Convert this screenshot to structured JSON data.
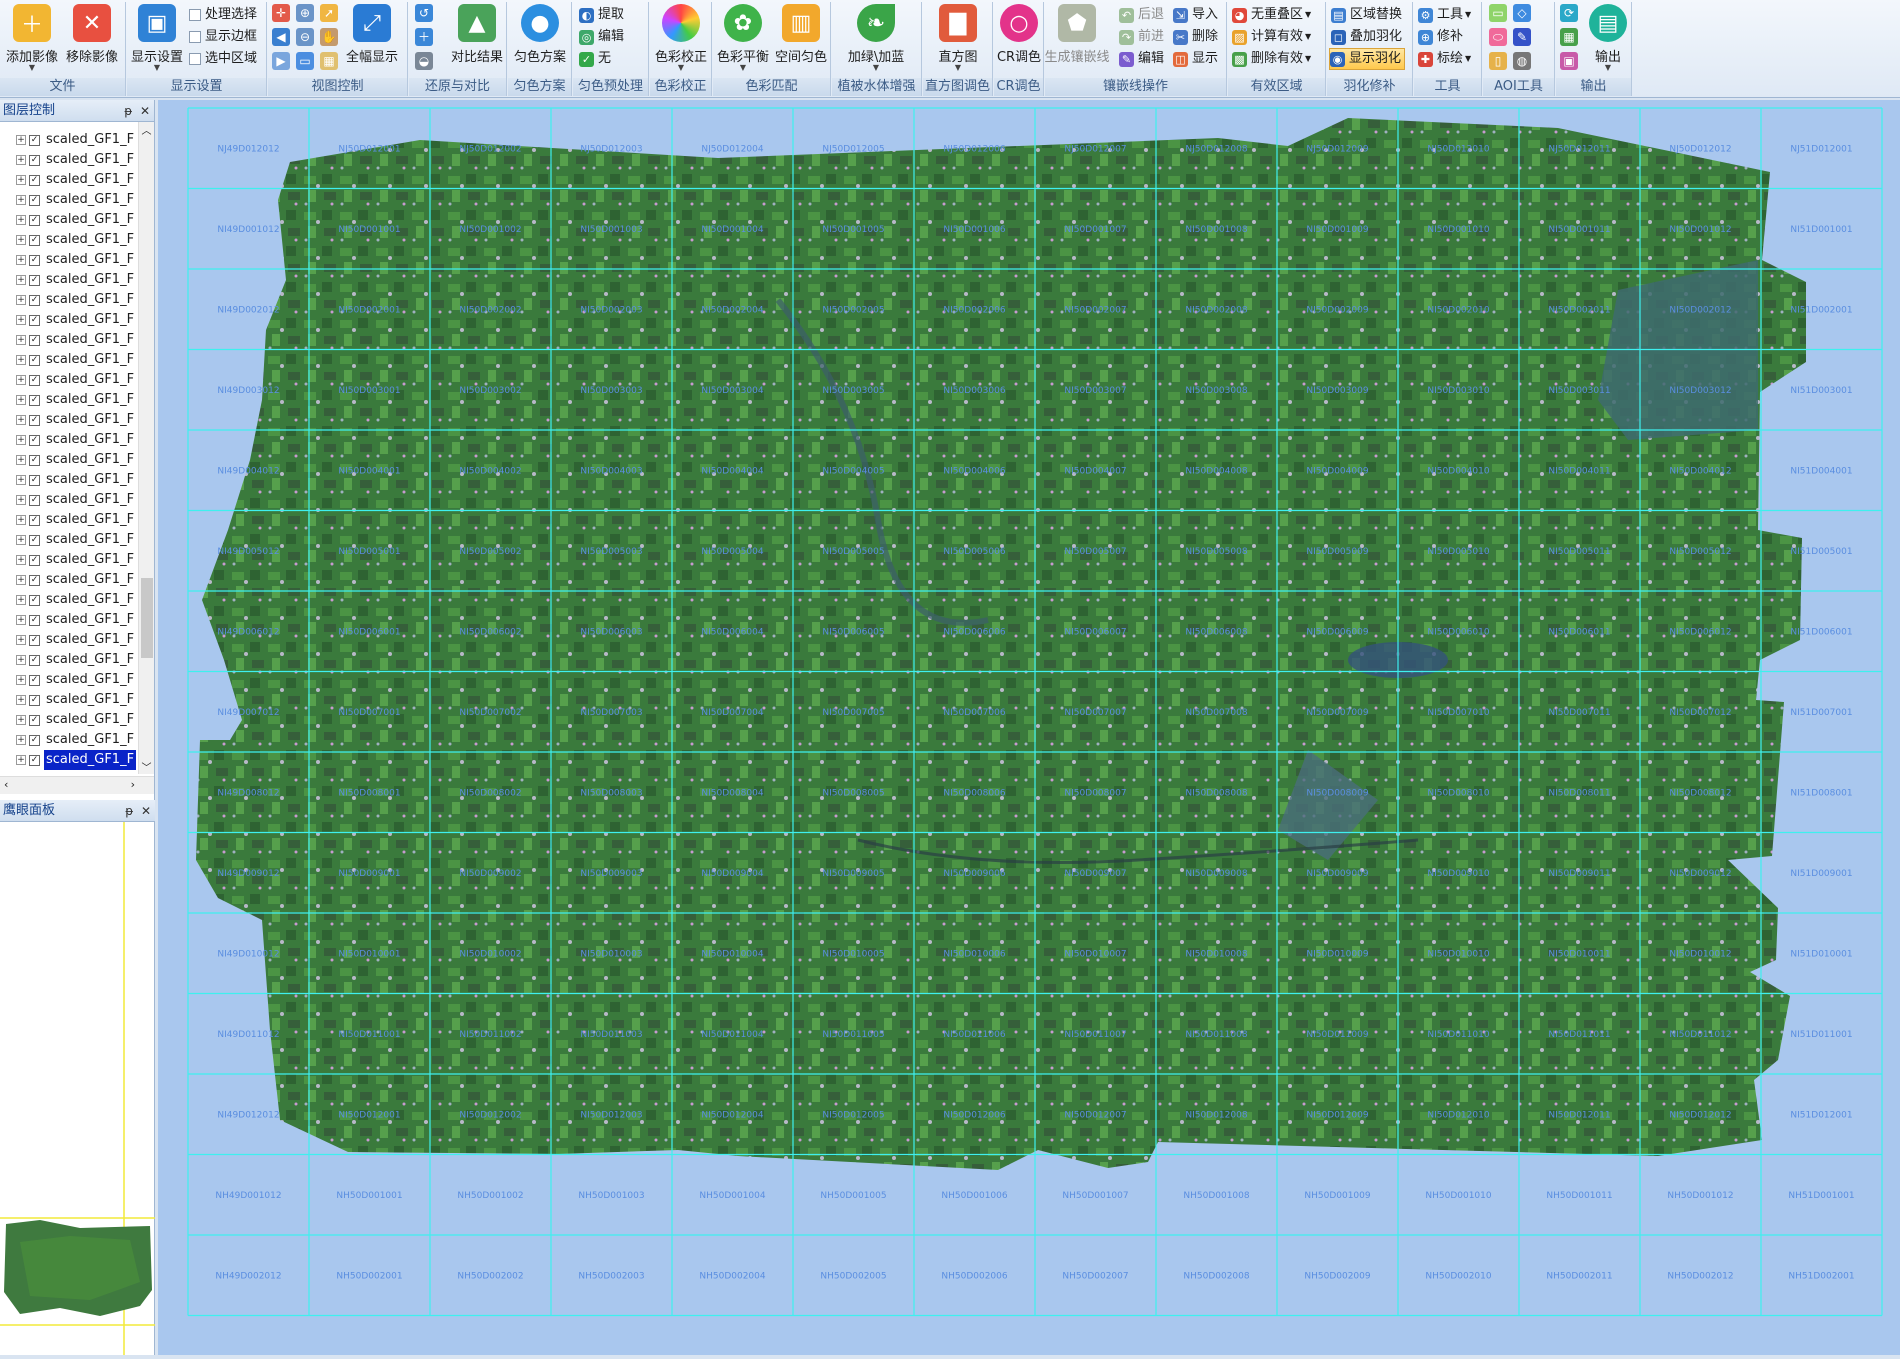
{
  "ribbon": {
    "file": {
      "title": "文件",
      "add": "添加影像",
      "remove": "移除影像"
    },
    "display": {
      "title": "显示设置",
      "settings": "显示设置",
      "opt1": "处理选择",
      "opt2": "显示边框",
      "opt3": "选中区域"
    },
    "view": {
      "title": "视图控制",
      "full": "全幅显示"
    },
    "restore": {
      "title": "还原与对比",
      "compare": "对比结果"
    },
    "dodge_scheme": {
      "title": "匀色方案",
      "label": "匀色方案"
    },
    "dodge_pre": {
      "title": "匀色预处理",
      "extract": "提取",
      "edit": "编辑",
      "none": "无"
    },
    "color_correct": {
      "title": "色彩校正",
      "label": "色彩校正"
    },
    "color_match": {
      "title": "色彩匹配",
      "balance": "色彩平衡",
      "spatial": "空间匀色"
    },
    "veg": {
      "title": "植被水体增强",
      "label": "加绿\\加蓝"
    },
    "hist": {
      "title": "直方图调色",
      "label": "直方图"
    },
    "cr": {
      "title": "CR调色",
      "label": "CR调色"
    },
    "seam": {
      "title": "镶嵌线操作",
      "gen": "生成镶嵌线",
      "back": "后退",
      "fwd": "前进",
      "edit": "编辑",
      "import": "导入",
      "delete": "删除",
      "show": "显示"
    },
    "valid": {
      "title": "有效区域",
      "no_overlap": "无重叠区",
      "calc": "计算有效",
      "del": "删除有效"
    },
    "feather": {
      "title": "羽化修补",
      "replace": "区域替换",
      "overlay": "叠加羽化",
      "show": "显示羽化"
    },
    "tools": {
      "title": "工具",
      "tool": "工具",
      "repair": "修补",
      "mark": "标绘"
    },
    "aoi": {
      "title": "AOI工具"
    },
    "output": {
      "title": "输出",
      "label": "输出"
    }
  },
  "layers_panel": {
    "title": "图层控制",
    "pin": "ᵽ",
    "close": "✕",
    "item_label": "scaled_GF1_F",
    "count": 32,
    "selected_index": 31
  },
  "eagle_panel": {
    "title": "鹰眼面板"
  },
  "grid": {
    "rows": [
      [
        "NJ49D012012",
        "NJ50D012001",
        "NJ50D012002",
        "NJ50D012003",
        "NJ50D012004",
        "NJ50D012005",
        "NJ50D012006",
        "NJ50D012007",
        "NJ50D012008",
        "NJ50D012009",
        "NJ50D012010",
        "NJ50D012011",
        "NJ50D012012",
        "NJ51D012001"
      ],
      [
        "NI49D001012",
        "NI50D001001",
        "NI50D001002",
        "NI50D001003",
        "NI50D001004",
        "NI50D001005",
        "NI50D001006",
        "NI50D001007",
        "NI50D001008",
        "NI50D001009",
        "NI50D001010",
        "NI50D001011",
        "NI50D001012",
        "NI51D001001"
      ],
      [
        "NI49D002012",
        "NI50D002001",
        "NI50D002002",
        "NI50D002003",
        "NI50D002004",
        "NI50D002005",
        "NI50D002006",
        "NI50D002007",
        "NI50D002008",
        "NI50D002009",
        "NI50D002010",
        "NI50D002011",
        "NI50D002012",
        "NI51D002001"
      ],
      [
        "NI49D003012",
        "NI50D003001",
        "NI50D003002",
        "NI50D003003",
        "NI50D003004",
        "NI50D003005",
        "NI50D003006",
        "NI50D003007",
        "NI50D003008",
        "NI50D003009",
        "NI50D003010",
        "NI50D003011",
        "NI50D003012",
        "NI51D003001"
      ],
      [
        "NI49D004012",
        "NI50D004001",
        "NI50D004002",
        "NI50D004003",
        "NI50D004004",
        "NI50D004005",
        "NI50D004006",
        "NI50D004007",
        "NI50D004008",
        "NI50D004009",
        "NI50D004010",
        "NI50D004011",
        "NI50D004012",
        "NI51D004001"
      ],
      [
        "NI49D005012",
        "NI50D005001",
        "NI50D005002",
        "NI50D005003",
        "NI50D005004",
        "NI50D005005",
        "NI50D005006",
        "NI50D005007",
        "NI50D005008",
        "NI50D005009",
        "NI50D005010",
        "NI50D005011",
        "NI50D005012",
        "NI51D005001"
      ],
      [
        "NI49D006012",
        "NI50D006001",
        "NI50D006002",
        "NI50D006003",
        "NI50D006004",
        "NI50D006005",
        "NI50D006006",
        "NI50D006007",
        "NI50D006008",
        "NI50D006009",
        "NI50D006010",
        "NI50D006011",
        "NI50D006012",
        "NI51D006001"
      ],
      [
        "NI49D007012",
        "NI50D007001",
        "NI50D007002",
        "NI50D007003",
        "NI50D007004",
        "NI50D007005",
        "NI50D007006",
        "NI50D007007",
        "NI50D007008",
        "NI50D007009",
        "NI50D007010",
        "NI50D007011",
        "NI50D007012",
        "NI51D007001"
      ],
      [
        "NI49D008012",
        "NI50D008001",
        "NI50D008002",
        "NI50D008003",
        "NI50D008004",
        "NI50D008005",
        "NI50D008006",
        "NI50D008007",
        "NI50D008008",
        "NI50D008009",
        "NI50D008010",
        "NI50D008011",
        "NI50D008012",
        "NI51D008001"
      ],
      [
        "NI49D009012",
        "NI50D009001",
        "NI50D009002",
        "NI50D009003",
        "NI50D009004",
        "NI50D009005",
        "NI50D009006",
        "NI50D009007",
        "NI50D009008",
        "NI50D009009",
        "NI50D009010",
        "NI50D009011",
        "NI50D009012",
        "NI51D009001"
      ],
      [
        "NI49D010012",
        "NI50D010001",
        "NI50D010002",
        "NI50D010003",
        "NI50D010004",
        "NI50D010005",
        "NI50D010006",
        "NI50D010007",
        "NI50D010008",
        "NI50D010009",
        "NI50D010010",
        "NI50D010011",
        "NI50D010012",
        "NI51D010001"
      ],
      [
        "NI49D011012",
        "NI50D011001",
        "NI50D011002",
        "NI50D011003",
        "NI50D011004",
        "NI50D011005",
        "NI50D011006",
        "NI50D011007",
        "NI50D011008",
        "NI50D011009",
        "NI50D011010",
        "NI50D011011",
        "NI50D011012",
        "NI51D011001"
      ],
      [
        "NI49D012012",
        "NI50D012001",
        "NI50D012002",
        "NI50D012003",
        "NI50D012004",
        "NI50D012005",
        "NI50D012006",
        "NI50D012007",
        "NI50D012008",
        "NI50D012009",
        "NI50D012010",
        "NI50D012011",
        "NI50D012012",
        "NI51D012001"
      ],
      [
        "NH49D001012",
        "NH50D001001",
        "NH50D001002",
        "NH50D001003",
        "NH50D001004",
        "NH50D001005",
        "NH50D001006",
        "NH50D001007",
        "NH50D001008",
        "NH50D001009",
        "NH50D001010",
        "NH50D001011",
        "NH50D001012",
        "NH51D001001"
      ],
      [
        "NH49D002012",
        "NH50D002001",
        "NH50D002002",
        "NH50D002003",
        "NH50D002004",
        "NH50D002005",
        "NH50D002006",
        "NH50D002007",
        "NH50D002008",
        "NH50D002009",
        "NH50D002010",
        "NH50D002011",
        "NH50D002012",
        "NH51D002001"
      ]
    ]
  },
  "colors": {
    "map_bg": "#a9c7ee",
    "grid_line": "#3ef0ee",
    "selection": "#0a24c8"
  }
}
